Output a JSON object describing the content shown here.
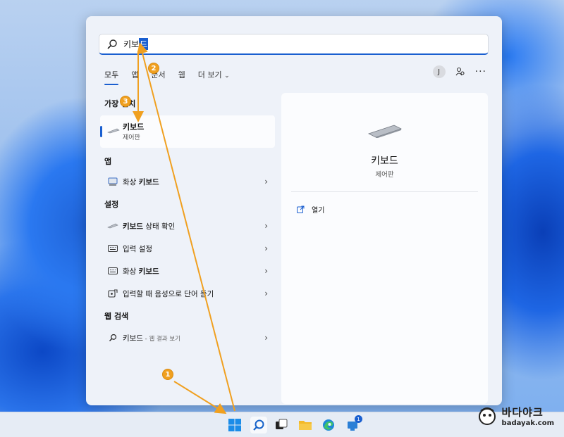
{
  "search": {
    "query_prefix": "키보",
    "query_selected": "드"
  },
  "tabs": [
    {
      "label": "모두"
    },
    {
      "label": "앱"
    },
    {
      "label": "문서"
    },
    {
      "label": "웹"
    },
    {
      "label": "더 보기"
    }
  ],
  "account_initial": "J",
  "sections": {
    "best_match": "가장 일치",
    "apps": "앱",
    "settings": "설정",
    "web": "웹 검색"
  },
  "best_match": {
    "title": "키보드",
    "subtitle": "제어판"
  },
  "apps": [
    {
      "label_plain": "화상 ",
      "label_bold": "키보드"
    }
  ],
  "settings": [
    {
      "label_bold": "키보드",
      "label_plain": " 상태 확인"
    },
    {
      "label_bold": "",
      "label_plain": "입력 설정"
    },
    {
      "label_bold": "키보드",
      "label_plain": "화상 "
    },
    {
      "label_bold": "",
      "label_plain": "입력할 때 음성으로 단어 듣기"
    }
  ],
  "web_result": {
    "label": "키보드",
    "sub": " - 웹 결과 보기"
  },
  "detail": {
    "title": "키보드",
    "subtitle": "제어판",
    "open_label": "열기"
  },
  "taskbar_badge": "1",
  "callouts": [
    "1",
    "2",
    "3"
  ],
  "watermark": {
    "line1": "바다야크",
    "line2": "badayak.com"
  },
  "colors": {
    "accent": "#1a5fd0",
    "callout": "#f0a020"
  }
}
